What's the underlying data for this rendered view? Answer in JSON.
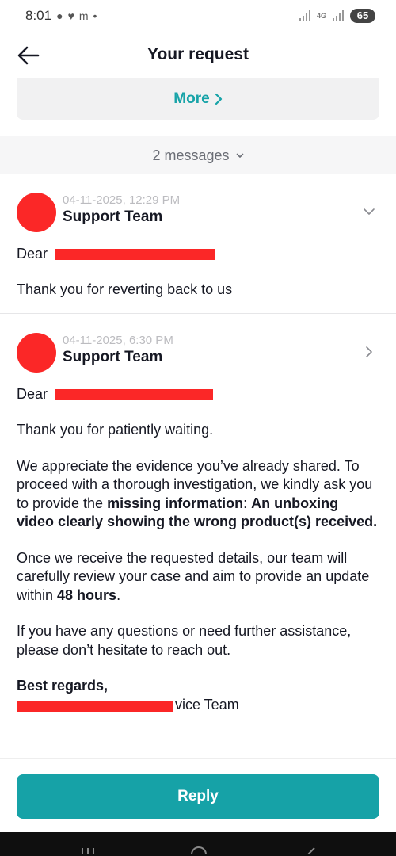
{
  "status_bar": {
    "time": "8:01",
    "network": "4G",
    "battery": "65"
  },
  "header": {
    "title": "Your request"
  },
  "more_card": {
    "label": "More"
  },
  "thread": {
    "count_label": "2 messages"
  },
  "messages": [
    {
      "date": "04-11-2025, 12:29 PM",
      "sender": "Support Team",
      "greeting": "Dear",
      "lines": [
        "Thank you for reverting back to us"
      ]
    },
    {
      "date": "04-11-2025, 6:30 PM",
      "sender": "Support Team",
      "greeting": "Dear",
      "p1": "Thank you for patiently waiting.",
      "p2_a": "We appreciate the evidence you’ve already shared. To proceed with a thorough investigation, we kindly ask you to provide the ",
      "p2_b": "missing information",
      "p2_c": ":",
      "p2_d": "An unboxing video clearly showing the wrong product(s) received.",
      "p3_a": "Once we receive the requested details, our team will carefully review your case and aim to provide an update within ",
      "p3_b": "48 hours",
      "p3_c": ".",
      "p4": "If you have any questions or need further assistance, please don’t hesitate to reach out.",
      "signoff": "Best regards,",
      "signature_tail": "vice Team"
    }
  ],
  "footer": {
    "reply_label": "Reply"
  },
  "colors": {
    "accent": "#16a2a7",
    "redaction": "#fb2727",
    "muted": "#6b6e76"
  }
}
